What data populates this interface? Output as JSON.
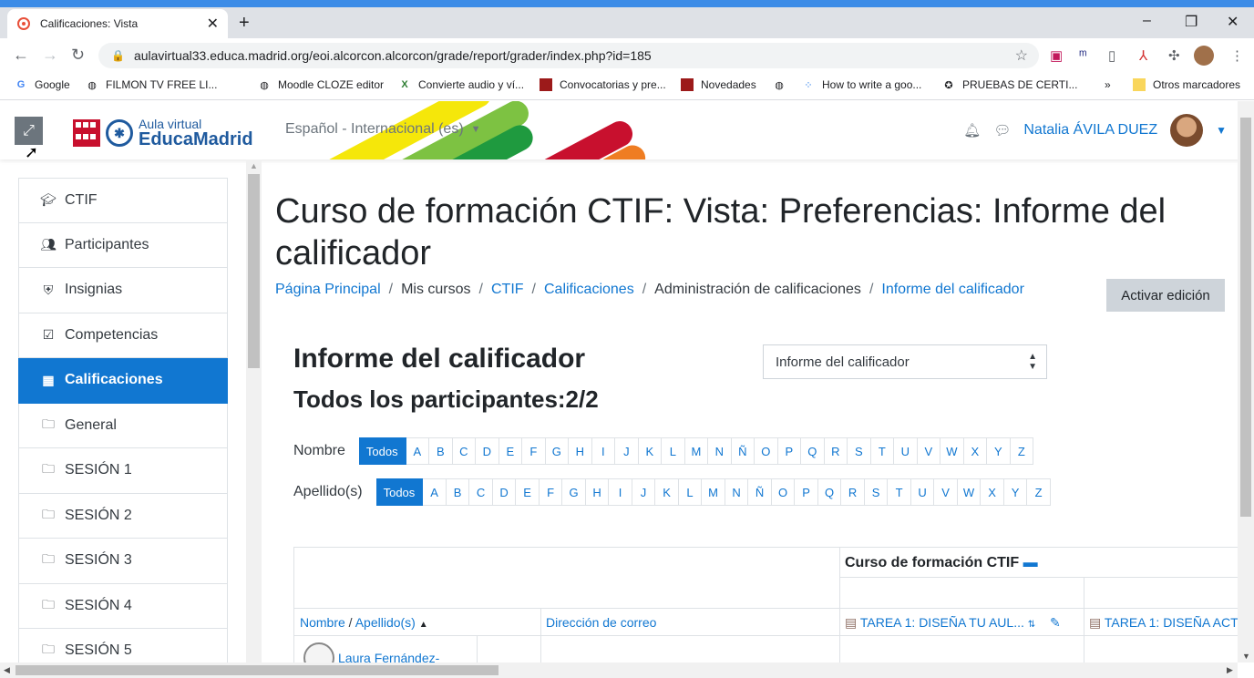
{
  "browser": {
    "tab_title": "Calificaciones: Vista",
    "tab_close": "✕",
    "new_tab": "+",
    "url": "aulavirtual33.educa.madrid.org/eoi.alcorcon.alcorcon/grade/report/grader/index.php?id=185",
    "bookmarks": [
      "Google",
      "FILMON TV FREE LI...",
      "Moodle CLOZE editor",
      "Convierte audio y ví...",
      "Convocatorias y pre...",
      "Novedades",
      "How to write a goo...",
      "PRUEBAS DE CERTI..."
    ],
    "bookmarks_more": "»",
    "other_bookmarks": "Otros marcadores"
  },
  "site": {
    "logo_top": "Aula virtual",
    "logo_bottom": "EducaMadrid",
    "language": "Español - Internacional (es)",
    "user_name": "Natalia ÁVILA DUEZ"
  },
  "drawer": {
    "items": [
      {
        "label": "CTIF",
        "icon": "graduation-cap-icon"
      },
      {
        "label": "Participantes",
        "icon": "users-icon"
      },
      {
        "label": "Insignias",
        "icon": "shield-icon"
      },
      {
        "label": "Competencias",
        "icon": "check-square-icon"
      },
      {
        "label": "Calificaciones",
        "icon": "table-icon",
        "active": true
      },
      {
        "label": "General",
        "icon": "folder-icon"
      },
      {
        "label": "SESIÓN 1",
        "icon": "folder-icon"
      },
      {
        "label": "SESIÓN 2",
        "icon": "folder-icon"
      },
      {
        "label": "SESIÓN 3",
        "icon": "folder-icon"
      },
      {
        "label": "SESIÓN 4",
        "icon": "folder-icon"
      },
      {
        "label": "SESIÓN 5",
        "icon": "folder-icon"
      }
    ]
  },
  "page": {
    "heading": "Curso de formación CTIF: Vista: Preferencias: Informe del calificador",
    "breadcrumb": [
      {
        "label": "Página Principal",
        "link": true
      },
      {
        "label": "Mis cursos",
        "link": false
      },
      {
        "label": "CTIF",
        "link": true
      },
      {
        "label": "Calificaciones",
        "link": true
      },
      {
        "label": "Administración de calificaciones",
        "link": false
      },
      {
        "label": "Informe del calificador",
        "link": true
      }
    ],
    "edit_button": "Activar edición",
    "report_title": "Informe del calificador",
    "participants": "Todos los participantes:2/2",
    "report_select": "Informe del calificador"
  },
  "initials": {
    "first_label": "Nombre",
    "last_label": "Apellido(s)",
    "all": "Todos",
    "letters": [
      "A",
      "B",
      "C",
      "D",
      "E",
      "F",
      "G",
      "H",
      "I",
      "J",
      "K",
      "L",
      "M",
      "N",
      "Ñ",
      "O",
      "P",
      "Q",
      "R",
      "S",
      "T",
      "U",
      "V",
      "W",
      "X",
      "Y",
      "Z"
    ]
  },
  "grader": {
    "course_header": "Curso de formación CTIF",
    "col_name": "Nombre",
    "col_name_sep": " / ",
    "col_lastname": "Apellido(s)",
    "col_email": "Dirección de correo",
    "col_task1": "TAREA 1: DISEÑA TU AUL...",
    "col_task2": "TAREA 1: DISEÑA ACT",
    "student_name": "Laura Fernández-"
  },
  "colors": {
    "primary": "#1177d1",
    "active_drawer": "#1177d1"
  }
}
